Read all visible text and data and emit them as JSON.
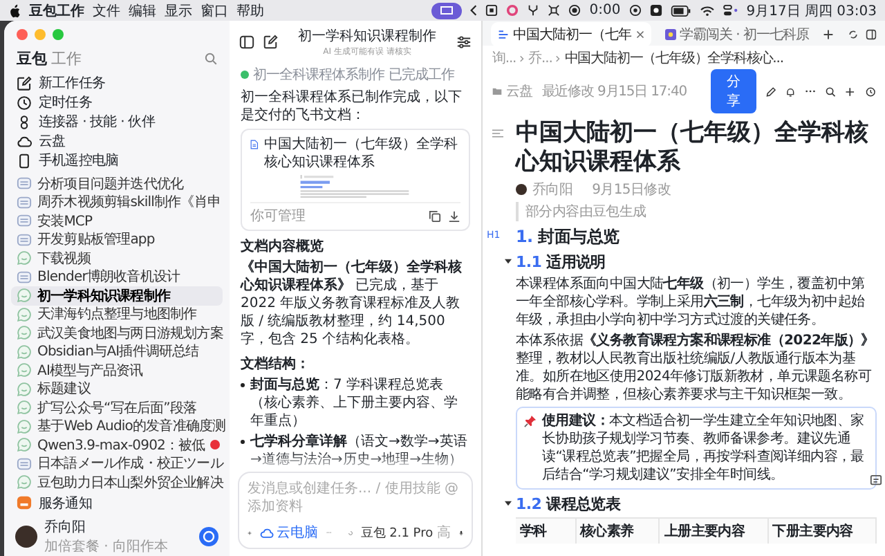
{
  "menu_bar": {
    "app_name": "豆包工作",
    "menus": [
      "文件",
      "编辑",
      "显示",
      "窗口",
      "帮助"
    ],
    "timer": "0:00",
    "clock": "9月17日 周四 03:03"
  },
  "sidebar": {
    "brand": "豆包",
    "brand_sub": "工作",
    "nav": [
      {
        "label": "新工作任务",
        "kind": "new"
      },
      {
        "label": "定时任务",
        "kind": "clock"
      },
      {
        "label": "连接器 · 技能 · 伙伴",
        "kind": "connector"
      },
      {
        "label": "云盘",
        "kind": "cloud"
      },
      {
        "label": "手机遥控电脑",
        "kind": "phone"
      }
    ],
    "history": [
      {
        "title": "分析项目问题并迭代优化",
        "kind": "doc",
        "selected": false,
        "alert": false
      },
      {
        "title": "周乔木视频剪辑skill制作《肖申",
        "kind": "doc",
        "selected": false,
        "alert": false
      },
      {
        "title": "安装MCP",
        "kind": "doc",
        "selected": false,
        "alert": false
      },
      {
        "title": "开发剪贴板管理app",
        "kind": "doc",
        "selected": false,
        "alert": false
      },
      {
        "title": "下载视频",
        "kind": "chat",
        "selected": false,
        "alert": false
      },
      {
        "title": "Blender博朗收音机设计",
        "kind": "doc",
        "selected": false,
        "alert": false
      },
      {
        "title": "初一学科知识课程制作",
        "kind": "chat",
        "selected": true,
        "alert": false
      },
      {
        "title": "天津海钓点整理与地图制作",
        "kind": "chat",
        "selected": false,
        "alert": false
      },
      {
        "title": "武汉美食地图与两日游规划方案",
        "kind": "chat",
        "selected": false,
        "alert": false
      },
      {
        "title": "Obsidian与AI插件调研总结",
        "kind": "chat",
        "selected": false,
        "alert": false
      },
      {
        "title": "AI模型与产品资讯",
        "kind": "chat",
        "selected": false,
        "alert": false
      },
      {
        "title": "标题建议",
        "kind": "chat",
        "selected": false,
        "alert": false
      },
      {
        "title": "扩写公众号“写在后面”段落",
        "kind": "chat",
        "selected": false,
        "alert": false
      },
      {
        "title": "基于Web Audio的发音准确度测",
        "kind": "chat",
        "selected": false,
        "alert": false
      },
      {
        "title": "Qwen3.9-max-0902：被低",
        "kind": "chat",
        "selected": false,
        "alert": true
      },
      {
        "title": "日本語メール作成・校正ツール",
        "kind": "doc",
        "selected": false,
        "alert": false
      },
      {
        "title": "豆包助力日本山梨外贸企业解决",
        "kind": "chat",
        "selected": false,
        "alert": false
      }
    ],
    "notice": "服务通知",
    "user": {
      "name": "乔向阳",
      "subtitle": "加倍套餐 · 向阳作本"
    }
  },
  "chat_panel": {
    "title": "初一学科知识课程制作",
    "subtitle": "AI 生成可能有误 请核实",
    "task": {
      "label": "初一全科课程体系制作",
      "status": "已完成工作",
      "done": true
    },
    "intro": "初一全科课程体系已制作完成，以下是交付的飞书文档：",
    "doc_card": {
      "title": "中国大陆初一（七年级）全学科核心知识课程体系",
      "footer": "你可管理"
    },
    "overview_heading": "文档内容概览",
    "overview": "**《中国大陆初一（七年级）全学科核心知识课程体系》** 已完成，基于 2022 年版义务教育课程标准及人教版 / 统编版教材整理，约 14,500 字，包含 25 个结构化表格。",
    "structure_heading": "文档结构：",
    "bullets": [
      "**封面与总览**：7 学科课程总览表（核心素养、上下册主要内容、学年重点）",
      "**七学科分章详解**（语文→数学→英语→道德与法治→历史→地理→生物）"
    ],
    "composer": {
      "placeholder": "发消息或创建任务... / 使用技能 @ 添加资料",
      "cloud_label": "云电脑",
      "model": "豆包 2.1 Pro",
      "effort": "高"
    }
  },
  "doc_window": {
    "tabs": [
      {
        "label": "中国大陆初一（七年",
        "selected": true,
        "kind": "doc"
      },
      {
        "label": "学霸闯关 · 初一七科原",
        "selected": false,
        "kind": "app"
      }
    ],
    "breadcrumb": [
      "询...",
      "乔...",
      "中国大陆初一（七年级）全学科核心..."
    ],
    "location": "云盘",
    "modified": "最近修改 9月15日 17:40",
    "share": "分享",
    "title": "中国大陆初一（七年级）全学科核心知识课程体系",
    "author": "乔向阳",
    "edited": "9月15日修改",
    "quote": "部分内容由豆包生成",
    "h1_marker": "H1",
    "blocks": [
      {
        "kind": "h1",
        "num": "1.",
        "text": "封面与总览"
      },
      {
        "kind": "h2",
        "num": "1.1",
        "text": "适用说明"
      },
      {
        "kind": "p",
        "text": "本课程体系面向中国大陆**七年级**（初一）学生，覆盖初中第一年全部核心学科。学制上采用**六三制**，七年级为初中起始年级，承担由小学向初中学习方式过渡的关键任务。"
      },
      {
        "kind": "p",
        "text": "本体系依据**《义务教育课程方案和课程标准（2022年版）》**整理，教材以人民教育出版社统编版/人教版通行版本为基准。如所在地区使用2024年修订版新教材，单元课题名称可能略有合并调整，但核心素养要求与主干知识框架一致。"
      },
      {
        "kind": "callout",
        "text": "**使用建议：**本文档适合初一学生建立全年知识地图、家长协助孩子规划学习节奏、教师备课参考。建议先通读“课程总览表”把握全局，再按学科查阅详细内容，最后结合“学习规划建议”安排全年时间线。"
      },
      {
        "kind": "h2",
        "num": "1.2",
        "text": "课程总览表"
      },
      {
        "kind": "table",
        "columns": [
          "学科",
          "核心素养",
          "上册主要内容",
          "下册主要内容"
        ]
      }
    ]
  }
}
